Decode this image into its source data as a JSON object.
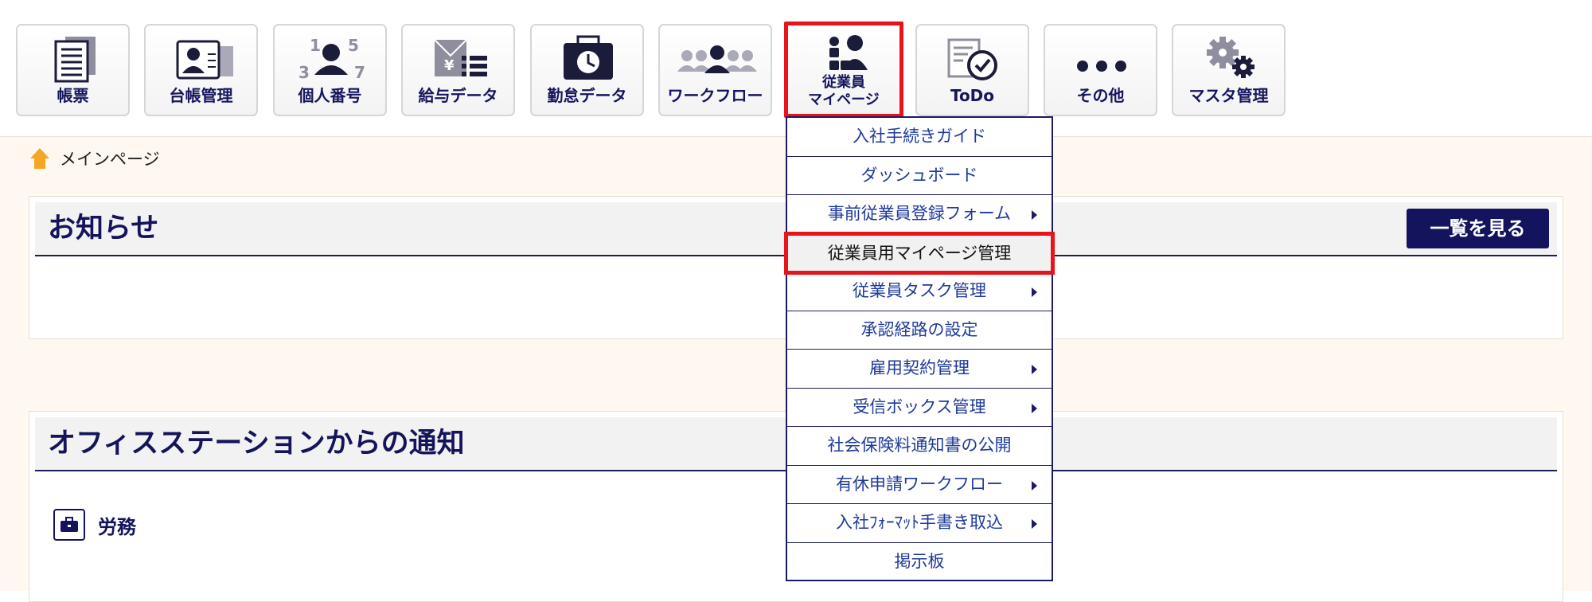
{
  "toolbar": {
    "items": [
      {
        "label": "帳票",
        "icon": "document-stack-icon"
      },
      {
        "label": "台帳管理",
        "icon": "id-card-icon"
      },
      {
        "label": "個人番号",
        "icon": "person-number-icon"
      },
      {
        "label": "給与データ",
        "icon": "yen-envelope-icon"
      },
      {
        "label": "勤怠データ",
        "icon": "timecard-clock-icon"
      },
      {
        "label": "ワークフロー",
        "icon": "people-group-icon"
      },
      {
        "label_line1": "従業員",
        "label_line2": "マイページ",
        "icon": "employee-gear-icon"
      },
      {
        "label": "ToDo",
        "icon": "todo-check-icon"
      },
      {
        "label": "その他",
        "icon": "ellipsis-icon"
      },
      {
        "label": "マスタ管理",
        "icon": "gears-icon"
      }
    ]
  },
  "breadcrumb": {
    "label": "メインページ",
    "icon": "home-icon"
  },
  "notices": {
    "title": "お知らせ",
    "list_button": "一覧を見る"
  },
  "office": {
    "title": "オフィスステーションからの通知",
    "section_label": "労務",
    "section_icon": "briefcase-icon"
  },
  "menu": {
    "items": [
      {
        "label": "入社手続きガイド",
        "submenu": false
      },
      {
        "label": "ダッシュボード",
        "submenu": false
      },
      {
        "label": "事前従業員登録フォーム",
        "submenu": true
      },
      {
        "label": "従業員用マイページ管理",
        "submenu": false,
        "highlighted": true
      },
      {
        "label": "従業員タスク管理",
        "submenu": true
      },
      {
        "label": "承認経路の設定",
        "submenu": false
      },
      {
        "label": "雇用契約管理",
        "submenu": true
      },
      {
        "label": "受信ボックス管理",
        "submenu": true
      },
      {
        "label": "社会保険料通知書の公開",
        "submenu": false
      },
      {
        "label": "有休申請ワークフロー",
        "submenu": true
      },
      {
        "label": "入社ﾌｫｰﾏｯﾄ手書き取込",
        "submenu": true
      },
      {
        "label": "掲示板",
        "submenu": false
      }
    ]
  },
  "colors": {
    "navy": "#14145e",
    "highlight_red": "#e8141a",
    "link_blue": "#1e3a9a",
    "page_bg": "#fff8f0"
  }
}
